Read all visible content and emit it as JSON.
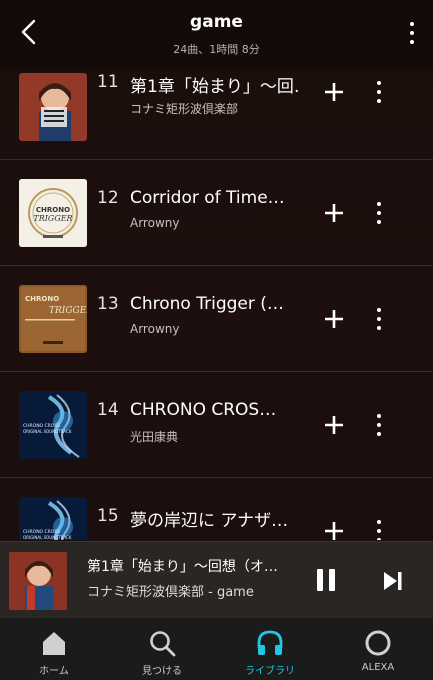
{
  "header": {
    "title": "game",
    "subtitle": "24曲、1時間 8分"
  },
  "tracks": [
    {
      "number": "11",
      "title": "第1章「始まり」～回…",
      "artist": "コナミ矩形波倶楽部",
      "art": "character-portrait"
    },
    {
      "number": "12",
      "title": "Corridor of Time…",
      "artist": "Arrowny",
      "art": "chrono-trigger-clock"
    },
    {
      "number": "13",
      "title": "Chrono Trigger (…",
      "artist": "Arrowny",
      "art": "chrono-trigger-bronze"
    },
    {
      "number": "14",
      "title": "CHRONO CROS…",
      "artist": "光田康典",
      "art": "chrono-cross-blue"
    },
    {
      "number": "15",
      "title": "夢の岸辺に アナザ…",
      "artist": "",
      "art": "chrono-cross-blue"
    }
  ],
  "now_playing": {
    "title": "第1章「始まり」～回想（オ…",
    "subtitle": "コナミ矩形波倶楽部 - game"
  },
  "nav": {
    "home": "ホーム",
    "discover": "見つける",
    "library": "ライブラリ",
    "alexa": "ALEXA"
  },
  "colors": {
    "accent": "#1ec8e6",
    "background": "#1a0d0a"
  }
}
